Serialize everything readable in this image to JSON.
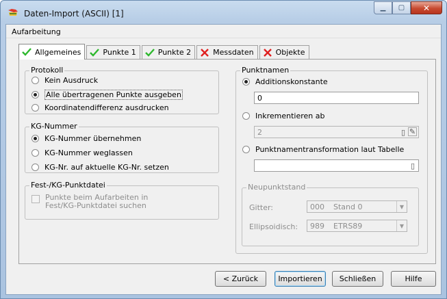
{
  "window": {
    "title": "Daten-Import (ASCII) [1]"
  },
  "menu": {
    "item": "Aufarbeitung"
  },
  "tabs": [
    {
      "label": "Allgemeines",
      "icon": "check-icon"
    },
    {
      "label": "Punkte 1",
      "icon": "check-icon"
    },
    {
      "label": "Punkte 2",
      "icon": "check-icon"
    },
    {
      "label": "Messdaten",
      "icon": "x-icon"
    },
    {
      "label": "Objekte",
      "icon": "x-icon"
    }
  ],
  "protokoll": {
    "label": "Protokoll",
    "options": [
      "Kein Ausdruck",
      "Alle übertragenen Punkte ausgeben",
      "Koordinatendifferenz ausdrucken"
    ],
    "selected": 1
  },
  "kg": {
    "label": "KG-Nummer",
    "options": [
      "KG-Nummer übernehmen",
      "KG-Nummer weglassen",
      "KG-Nr. auf aktuelle KG-Nr. setzen"
    ],
    "selected": 0
  },
  "fest": {
    "label": "Fest-/KG-Punktdatei",
    "checkbox_line1": "Punkte beim Aufarbeiten in",
    "checkbox_line2": "Fest/KG-Punktdatei suchen"
  },
  "punktnamen": {
    "label": "Punktnamen",
    "add_const_label": "Additionskonstante",
    "add_const_value": "0",
    "incr_label": "Inkrementieren ab",
    "incr_value": "2",
    "trans_label": "Punktnamentransformation laut Tabelle",
    "trans_value": ""
  },
  "neupunktstand": {
    "label": "Neupunktstand",
    "gitter_label": "Gitter:",
    "gitter_code": "000",
    "gitter_value": "Stand 0",
    "ellip_label": "Ellipsoidisch:",
    "ellip_code": "989",
    "ellip_value": "ETRS89"
  },
  "buttons": {
    "back": "< Zurück",
    "import": "Importieren",
    "close": "Schließen",
    "help": "Hilfe"
  },
  "colors": {
    "check": "#2db82d",
    "x": "#e02020"
  }
}
